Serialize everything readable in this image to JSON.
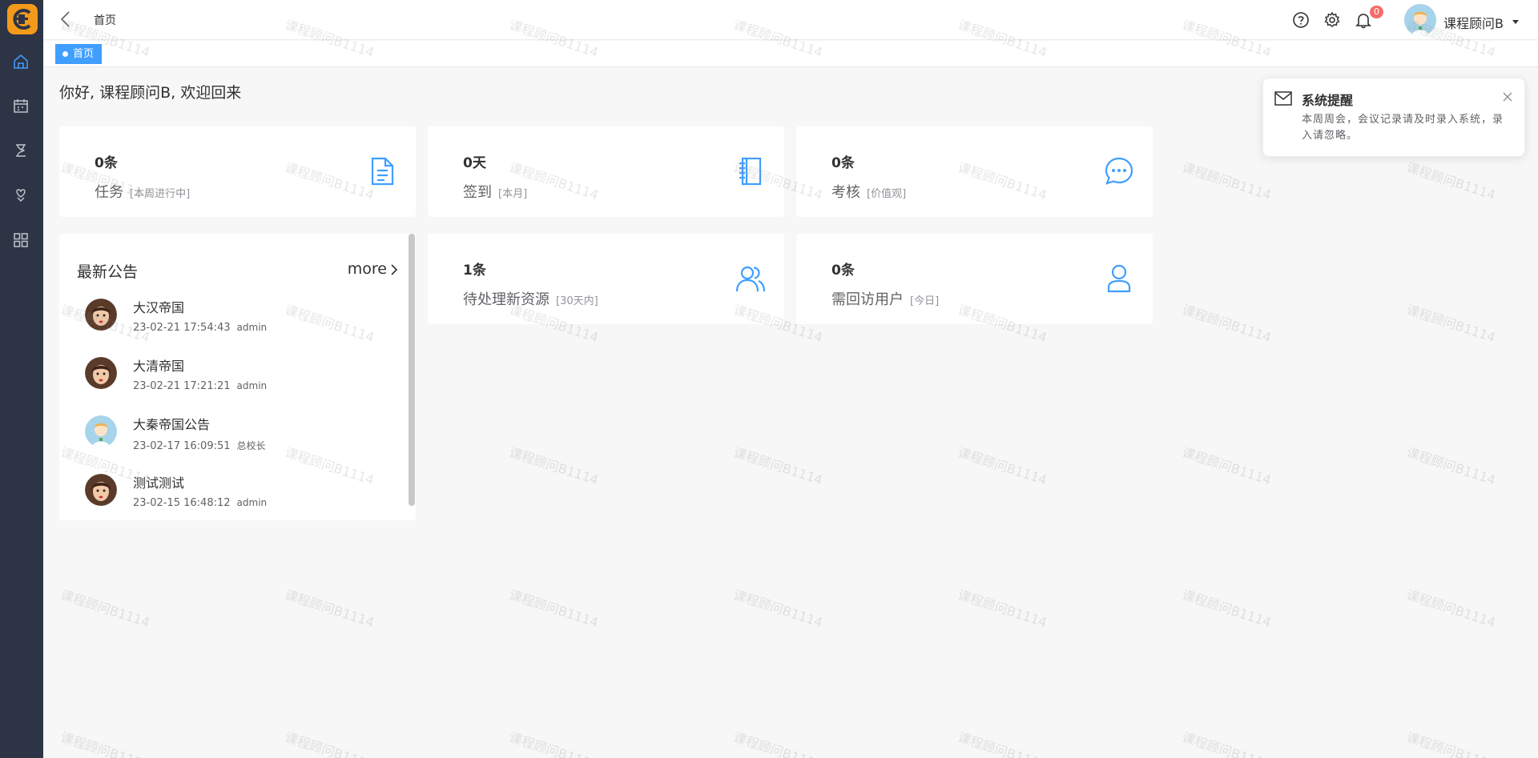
{
  "header": {
    "breadcrumb": "首页",
    "notification_count": "0",
    "user_name": "课程顾问B"
  },
  "tags": [
    {
      "label": "首页",
      "active": true
    }
  ],
  "sidebar": {
    "items": [
      {
        "icon": "home-icon",
        "active": true
      },
      {
        "icon": "calendar-icon",
        "active": false
      },
      {
        "icon": "hourglass-icon",
        "active": false
      },
      {
        "icon": "hand-heart-icon",
        "active": false
      },
      {
        "icon": "apps-grid-icon",
        "active": false
      }
    ]
  },
  "greeting": "你好, 课程顾问B, 欢迎回来",
  "stats": [
    {
      "value": "0条",
      "label": "任务",
      "sub": "[本周进行中]",
      "icon": "document-icon"
    },
    {
      "value": "0天",
      "label": "签到",
      "sub": "[本月]",
      "icon": "notebook-icon"
    },
    {
      "value": "0条",
      "label": "考核",
      "sub": "[价值观]",
      "icon": "chat-bubble-icon"
    },
    {
      "value": "1条",
      "label": "待处理新资源",
      "sub": "[30天内]",
      "icon": "users-icon"
    },
    {
      "value": "0条",
      "label": "需回访用户",
      "sub": "[今日]",
      "icon": "user-icon"
    }
  ],
  "notices": {
    "title": "最新公告",
    "more": "more",
    "items": [
      {
        "title": "大汉帝国",
        "time": "23-02-21 17:54:43",
        "author": "admin",
        "avatar": "woman-avatar"
      },
      {
        "title": "大清帝国",
        "time": "23-02-21 17:21:21",
        "author": "admin",
        "avatar": "woman-avatar"
      },
      {
        "title": "大秦帝国公告",
        "time": "23-02-17 16:09:51",
        "author": "总校长",
        "avatar": "kid-avatar"
      },
      {
        "title": "测试测试",
        "time": "23-02-15 16:48:12",
        "author": "admin",
        "avatar": "woman-avatar"
      }
    ]
  },
  "notification": {
    "title": "系统提醒",
    "message": "本周周会，会议记录请及时录入系统，录入请忽略。"
  },
  "watermark": "课程顾问B1114",
  "colors": {
    "accent": "#409eff",
    "sidebar": "#2d3445",
    "logo": "#f39a1a",
    "badge": "#f56c6c"
  }
}
